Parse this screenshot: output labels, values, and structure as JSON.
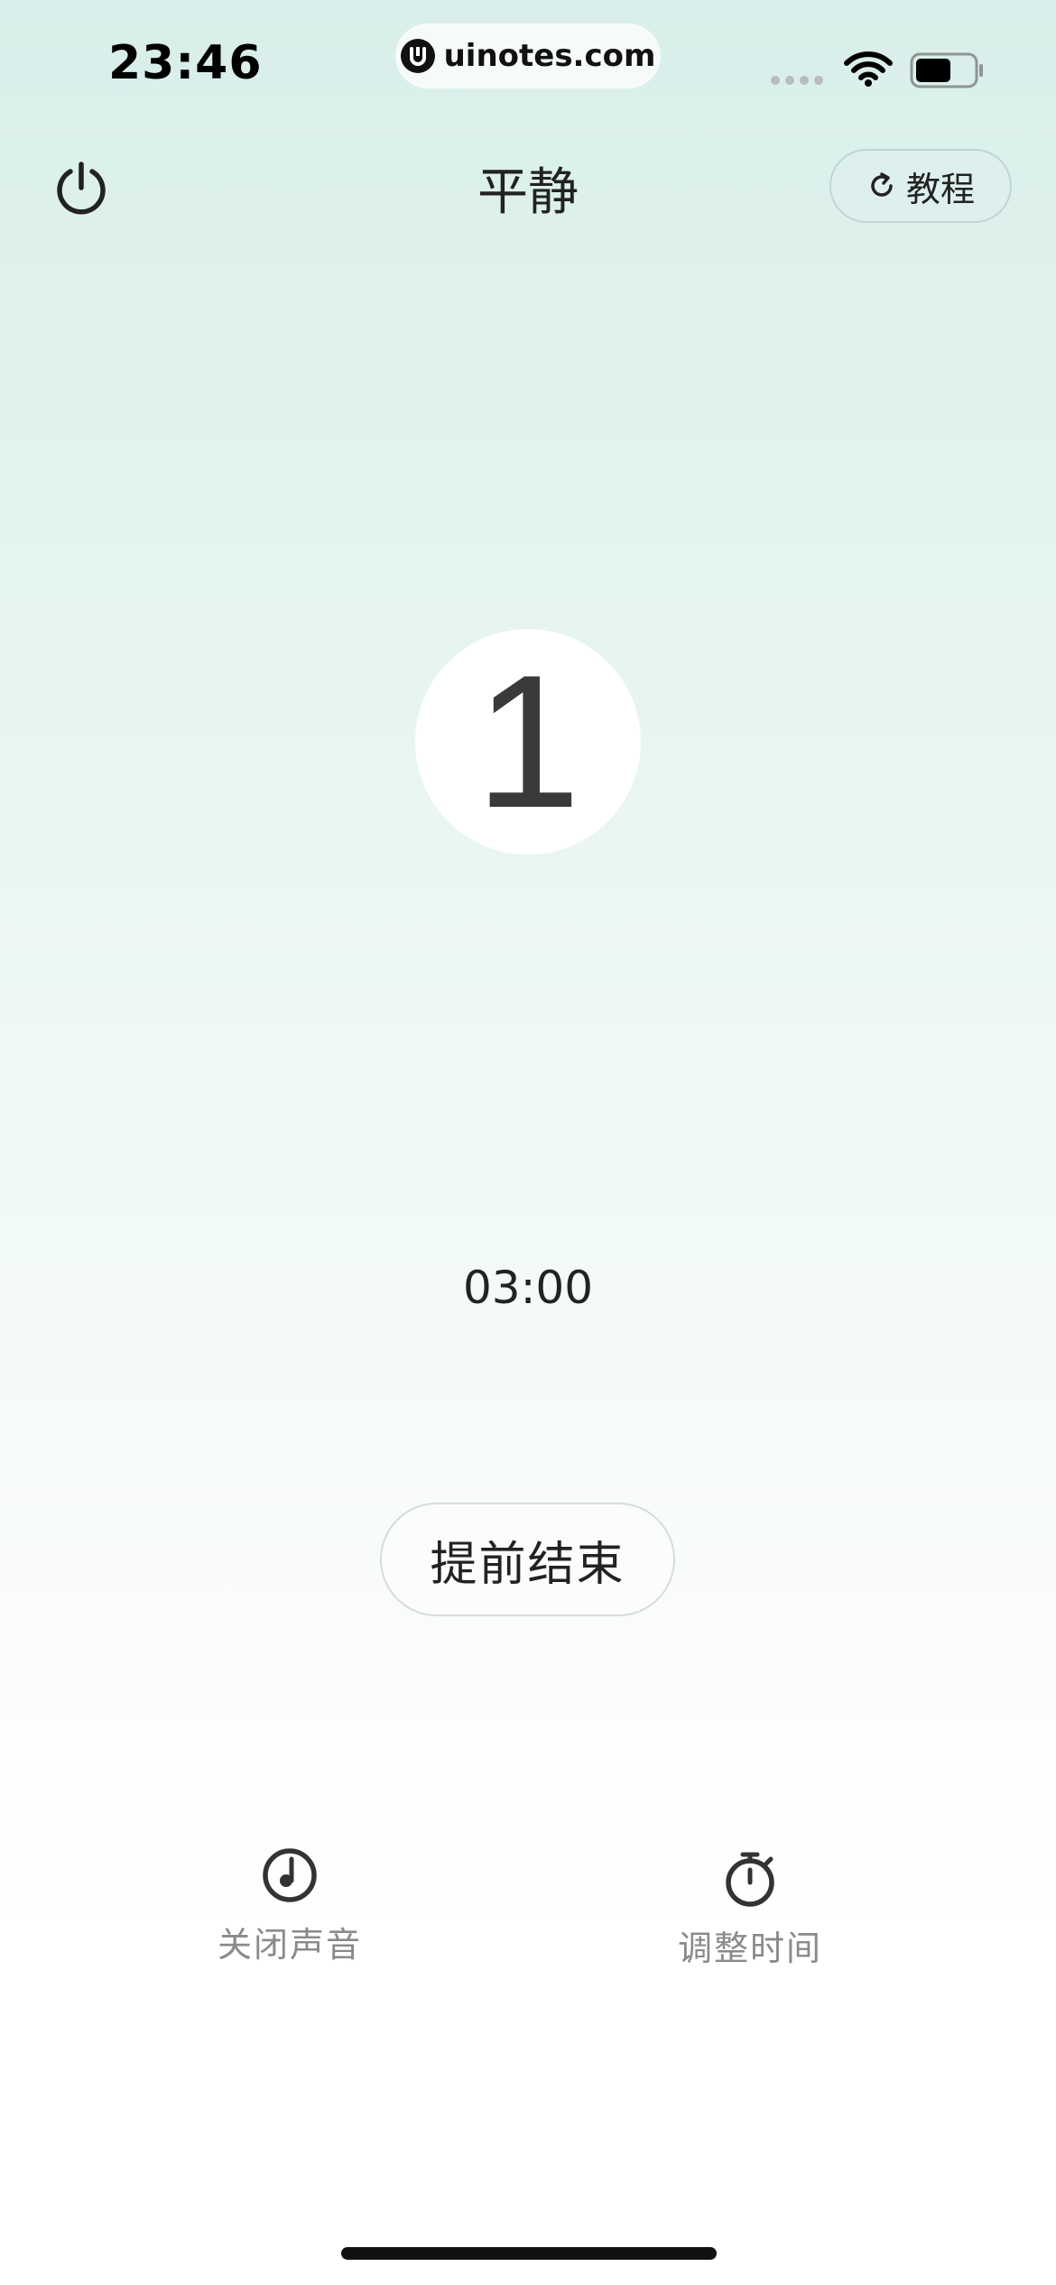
{
  "status_bar": {
    "time": "23:46",
    "url": "uinotes.com"
  },
  "header": {
    "title": "平静",
    "tutorial_label": "教程"
  },
  "counter": {
    "value": "1"
  },
  "timer": {
    "remaining": "03:00"
  },
  "end_button": {
    "label": "提前结束"
  },
  "actions": [
    {
      "label": "关闭声音",
      "icon": "music-note-icon"
    },
    {
      "label": "调整时间",
      "icon": "stopwatch-icon"
    }
  ],
  "colors": {
    "background_top": "#d9eeea",
    "background_bottom": "#ffffff",
    "text_primary": "#222222",
    "text_secondary": "#8a8a8a"
  }
}
